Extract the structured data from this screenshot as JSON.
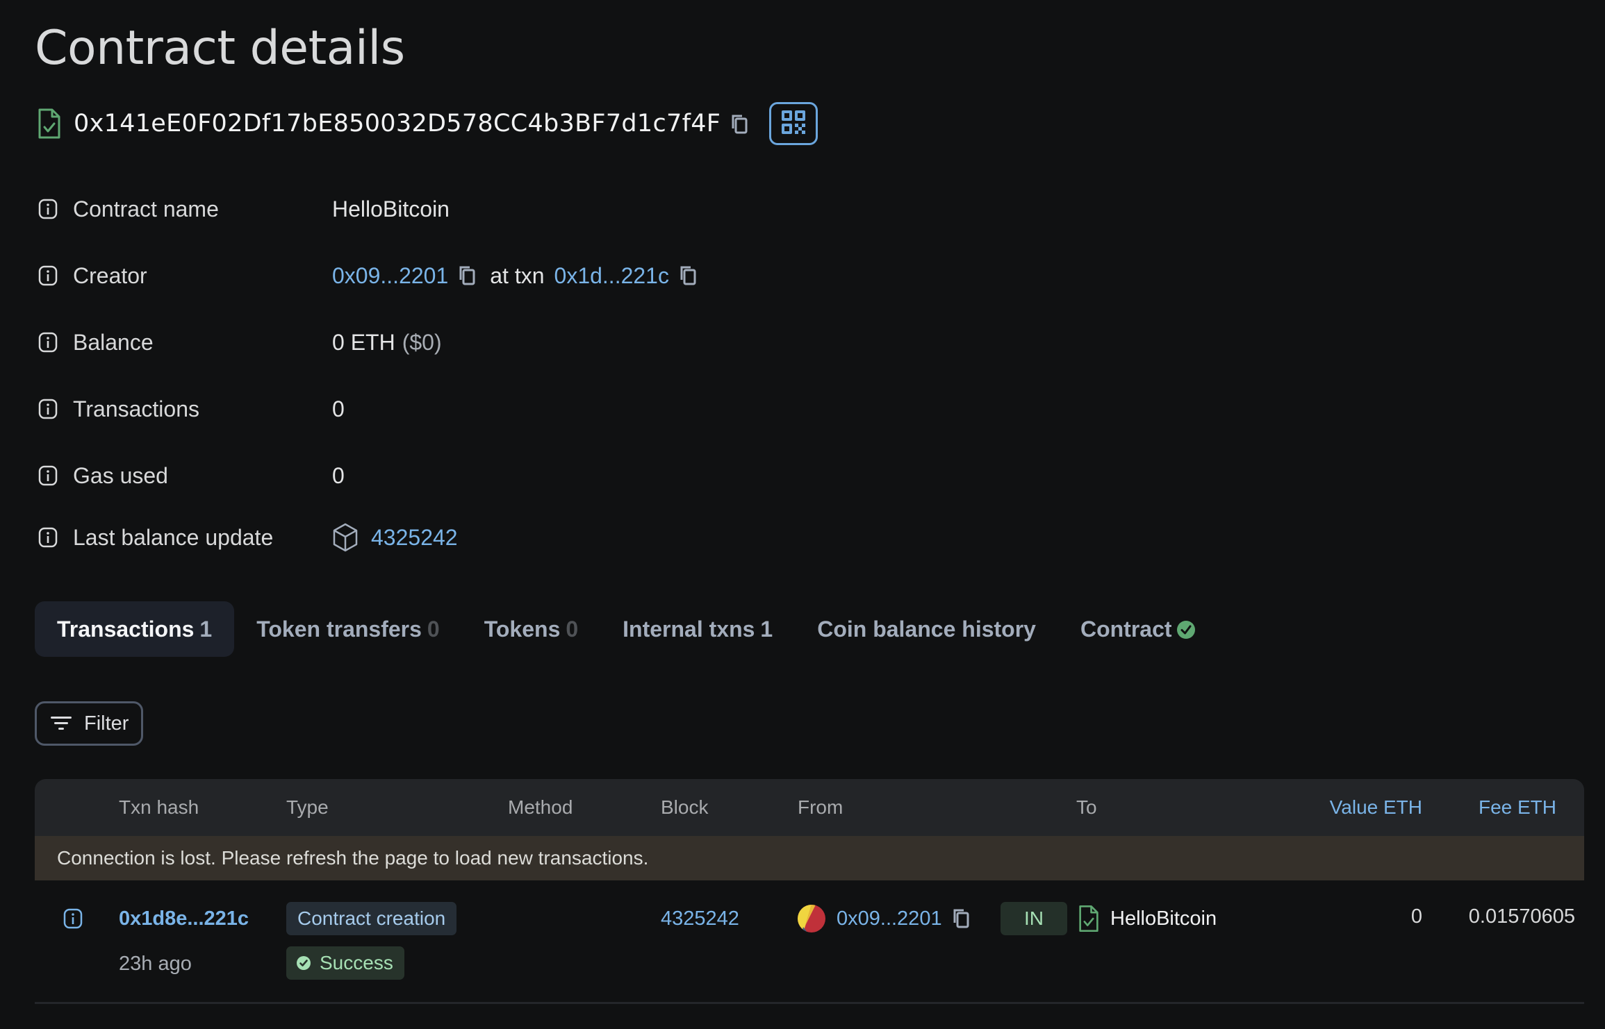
{
  "page": {
    "title": "Contract details"
  },
  "address": {
    "value": "0x141eE0F02Df17bE850032D578CC4b3BF7d1c7f4F",
    "icon": "contract-verified-icon",
    "copy_icon": "copy-icon",
    "qr_icon": "qr-code-icon"
  },
  "details": {
    "contract_name": {
      "label": "Contract name",
      "value": "HelloBitcoin"
    },
    "creator": {
      "label": "Creator",
      "address": "0x09...2201",
      "at_txn_label": "at txn",
      "txn": "0x1d...221c"
    },
    "balance": {
      "label": "Balance",
      "value": "0 ETH",
      "usd": "($0)"
    },
    "transactions": {
      "label": "Transactions",
      "value": "0"
    },
    "gas_used": {
      "label": "Gas used",
      "value": "0"
    },
    "last_balance_update": {
      "label": "Last balance update",
      "value": "4325242",
      "icon": "block-icon"
    }
  },
  "tabs": [
    {
      "label": "Transactions",
      "count": "1",
      "active": true
    },
    {
      "label": "Token transfers",
      "count": "0",
      "active": false
    },
    {
      "label": "Tokens",
      "count": "0",
      "active": false
    },
    {
      "label": "Internal txns",
      "count": "1",
      "active": false
    },
    {
      "label": "Coin balance history",
      "count": "",
      "active": false
    },
    {
      "label": "Contract",
      "count": "",
      "active": false,
      "verified": true
    }
  ],
  "filter": {
    "label": "Filter"
  },
  "table": {
    "columns": [
      "Txn hash",
      "Type",
      "Method",
      "Block",
      "From",
      "To",
      "Value ETH",
      "Fee ETH"
    ],
    "warning": "Connection is lost. Please refresh the page to load new transactions.",
    "rows": [
      {
        "hash": "0x1d8e...221c",
        "age": "23h ago",
        "type": "Contract creation",
        "status": "Success",
        "method": "",
        "block": "4325242",
        "from": "0x09...2201",
        "direction": "IN",
        "to": "HelloBitcoin",
        "value": "0",
        "fee": "0.01570605"
      }
    ]
  },
  "colors": {
    "background": "#101112",
    "link": "#7ab4e8",
    "verified_green": "#5fa872",
    "warning_bg": "#35302a"
  }
}
